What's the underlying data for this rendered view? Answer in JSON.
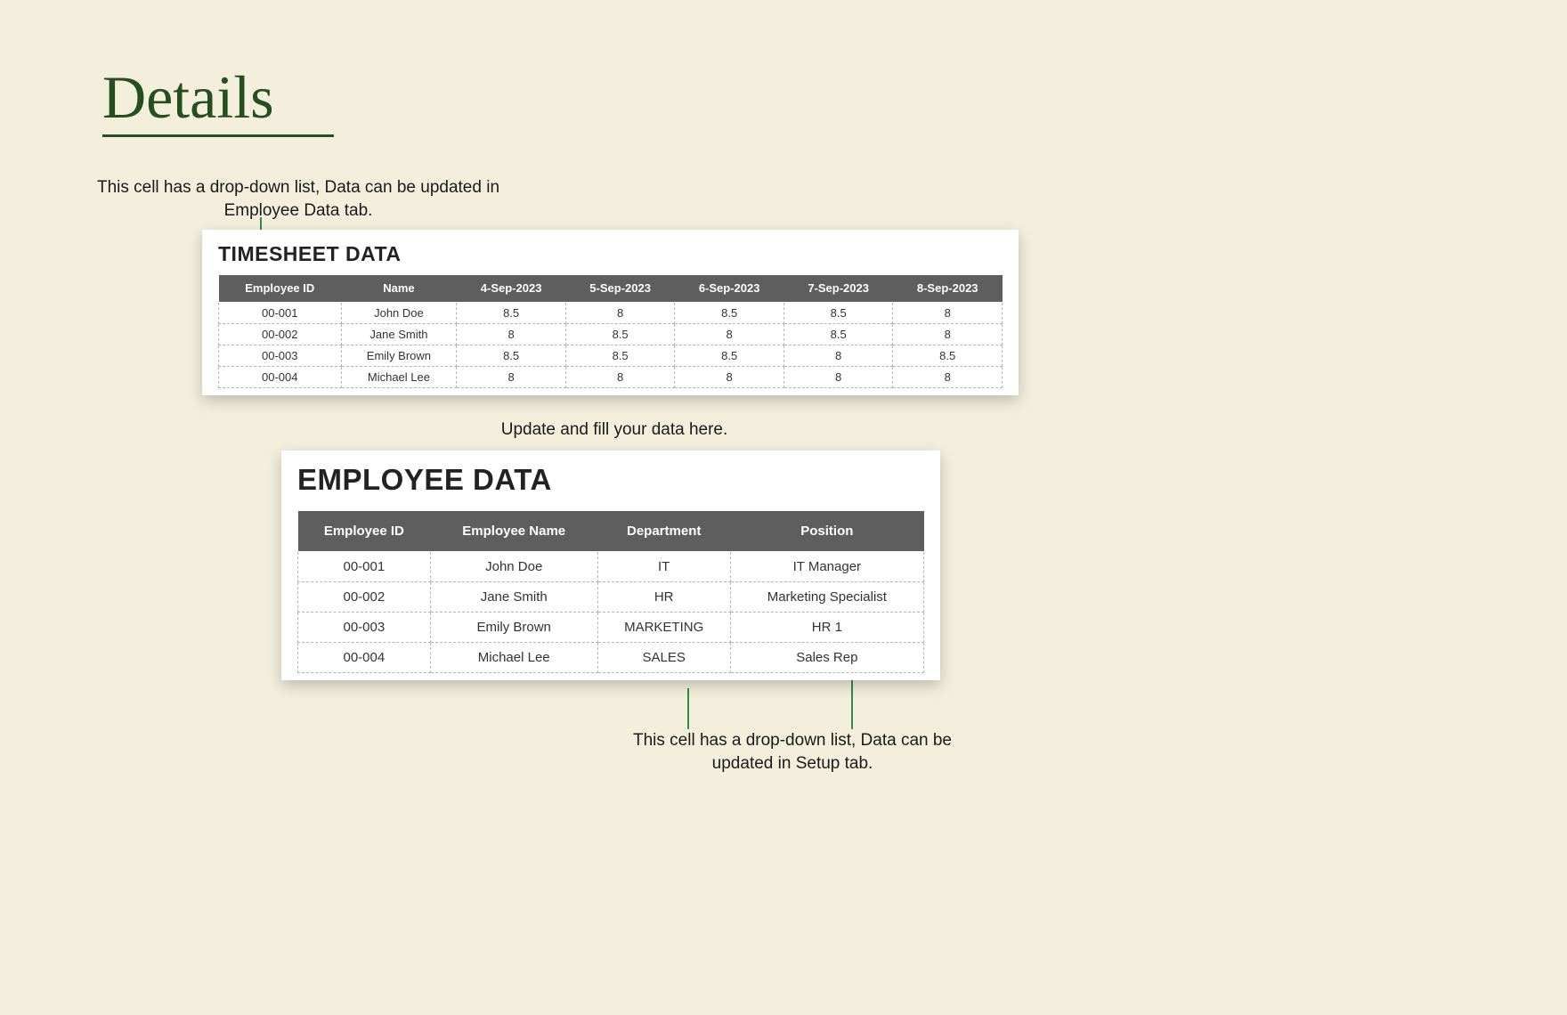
{
  "page": {
    "title": "Details"
  },
  "captions": {
    "top": "This cell has a drop-down list, Data can be updated in Employee Data tab.",
    "mid": "Update and fill your data here.",
    "bot": "This cell has a drop-down list, Data can be updated in Setup  tab."
  },
  "timesheet": {
    "title": "TIMESHEET DATA",
    "headers": [
      "Employee ID",
      "Name",
      "4-Sep-2023",
      "5-Sep-2023",
      "6-Sep-2023",
      "7-Sep-2023",
      "8-Sep-2023"
    ],
    "rows": [
      [
        "00-001",
        "John Doe",
        "8.5",
        "8",
        "8.5",
        "8.5",
        "8"
      ],
      [
        "00-002",
        "Jane Smith",
        "8",
        "8.5",
        "8",
        "8.5",
        "8"
      ],
      [
        "00-003",
        "Emily Brown",
        "8.5",
        "8.5",
        "8.5",
        "8",
        "8.5"
      ],
      [
        "00-004",
        "Michael Lee",
        "8",
        "8",
        "8",
        "8",
        "8"
      ]
    ]
  },
  "employee": {
    "title": "EMPLOYEE DATA",
    "headers": [
      "Employee ID",
      "Employee Name",
      "Department",
      "Position"
    ],
    "rows": [
      [
        "00-001",
        "John Doe",
        "IT",
        "IT Manager"
      ],
      [
        "00-002",
        "Jane Smith",
        "HR",
        "Marketing Specialist"
      ],
      [
        "00-003",
        "Emily Brown",
        "MARKETING",
        "HR 1"
      ],
      [
        "00-004",
        "Michael Lee",
        "SALES",
        "Sales Rep"
      ]
    ]
  }
}
